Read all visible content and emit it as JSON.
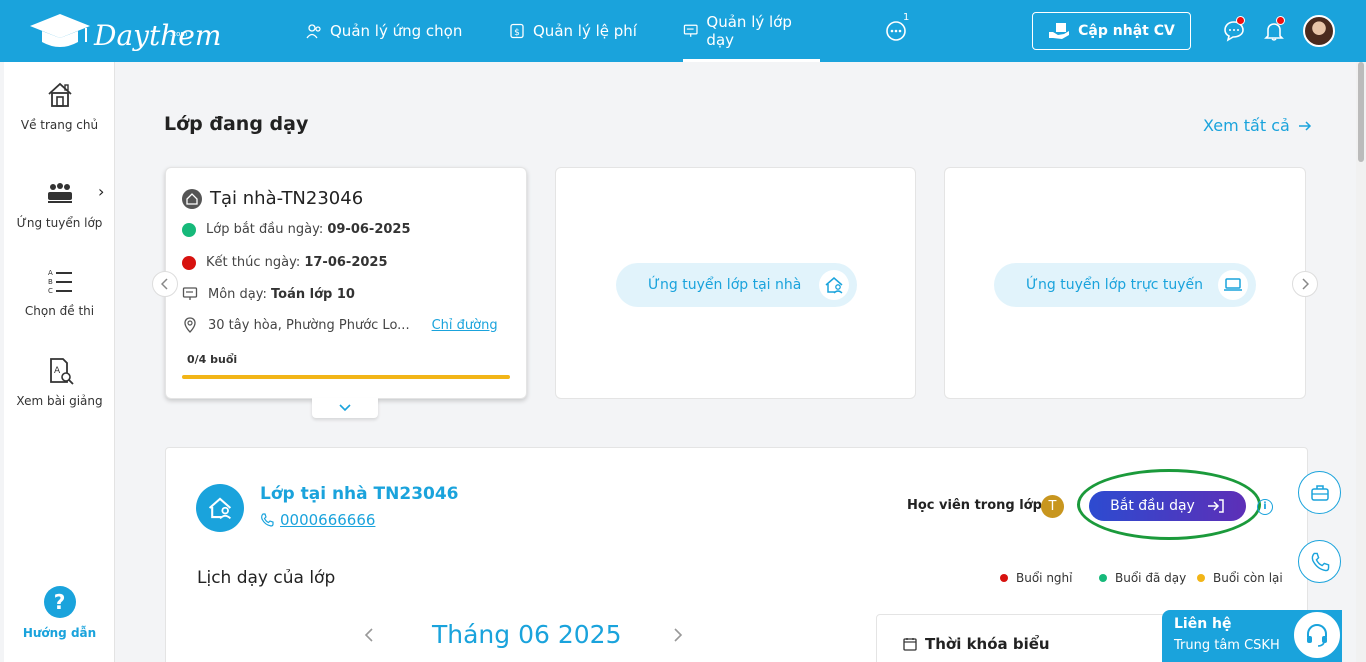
{
  "header": {
    "logo_text": "Daythem",
    "logo_sub": ".com",
    "nav": [
      {
        "label": "Quản lý ứng chọn"
      },
      {
        "label": "Quản lý lệ phí"
      },
      {
        "label": "Quản lý lớp dạy"
      }
    ],
    "chat_badge": "1",
    "cv_button": "Cập nhật CV"
  },
  "sidebar": {
    "items": [
      {
        "label": "Về trang chủ"
      },
      {
        "label": "Ứng tuyển lớp"
      },
      {
        "label": "Chọn đề thi"
      },
      {
        "label": "Xem bài giảng"
      }
    ],
    "help": "Hướng dẫn"
  },
  "section": {
    "title": "Lớp đang dạy",
    "see_all": "Xem tất cả"
  },
  "class_card": {
    "title": "Tại nhà-TN23046",
    "start_label": "Lớp bắt đầu ngày:",
    "start_date": "09-06-2025",
    "end_label": "Kết thúc ngày:",
    "end_date": "17-06-2025",
    "subject_label": "Môn dạy:",
    "subject": "Toán lớp 10",
    "address": "30 tây hòa, Phường Phước Lo...",
    "directions": "Chỉ đường",
    "sessions": "0/4 buổi"
  },
  "apply_cards": {
    "home": "Ứng tuyển lớp tại nhà",
    "online": "Ứng tuyển lớp trực tuyến"
  },
  "class_panel": {
    "name": "Lớp tại nhà TN23046",
    "phone": "0000666666",
    "students_label": "Học viên trong lớp:",
    "student_initial": "T",
    "start_button": "Bắt đầu dạy",
    "info": "i",
    "schedule_title": "Lịch dạy của lớp",
    "legend": [
      {
        "label": "Buổi nghỉ",
        "color": "#d7120f"
      },
      {
        "label": "Buổi đã dạy",
        "color": "#16b97a"
      },
      {
        "label": "Buổi còn lại",
        "color": "#f2b517"
      }
    ],
    "month": "Tháng 06 2025",
    "timetable": "Thời khóa biểu"
  },
  "contact": {
    "line1": "Liên hệ",
    "line2": "Trung tâm CSKH"
  },
  "colors": {
    "brand": "#1aa3dc",
    "start_gradient_from": "#2d4bd0",
    "start_gradient_to": "#5d2fb7",
    "highlight_ring": "#1b9a3b"
  }
}
